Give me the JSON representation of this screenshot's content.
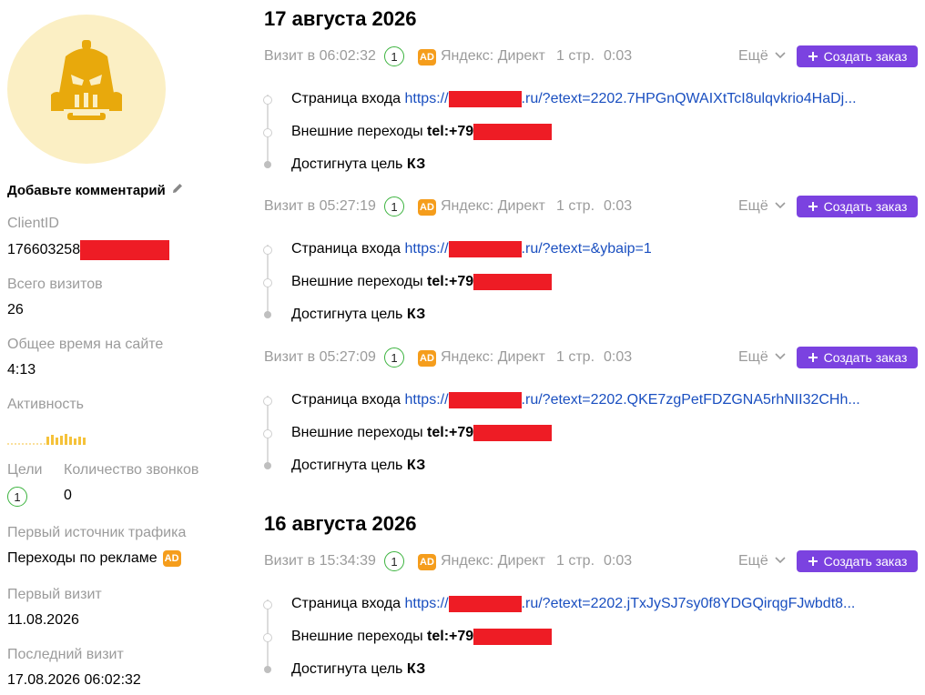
{
  "sidebar": {
    "comment_label": "Добавьте комментарий",
    "client_id_label": "ClientID",
    "client_id_value": "176603258",
    "total_visits_label": "Всего визитов",
    "total_visits_value": "26",
    "total_time_label": "Общее время на сайте",
    "total_time_value": "4:13",
    "activity_label": "Активность",
    "goals_label": "Цели",
    "goals_value": "1",
    "calls_label": "Количество звонков",
    "calls_value": "0",
    "first_source_label": "Первый источник трафика",
    "first_source_value": "Переходы по рекламе",
    "first_visit_label": "Первый визит",
    "first_visit_value": "11.08.2026",
    "last_visit_label": "Последний визит",
    "last_visit_value": "17.08.2026 06:02:32"
  },
  "ad_badge": "AD",
  "dates": [
    "17 августа 2026",
    "16 августа 2026"
  ],
  "visits": [
    {
      "time": "Визит в 06:02:32",
      "goals": "1",
      "source": "Яндекс: Директ",
      "pages": "1 стр.",
      "duration": "0:03",
      "more": "Ещё",
      "create": "Создать заказ",
      "entry_label": "Страница входа",
      "entry_prefix": "https://",
      "entry_suffix": ".ru/?etext=2202.7HPGnQWAIXtTcI8ulqvkrio4HaDj...",
      "ext_label": "Внешние переходы",
      "ext_value": "tel:+79",
      "goal_label": "Достигнута цель",
      "goal_value": "КЗ"
    },
    {
      "time": "Визит в 05:27:19",
      "goals": "1",
      "source": "Яндекс: Директ",
      "pages": "1 стр.",
      "duration": "0:03",
      "more": "Ещё",
      "create": "Создать заказ",
      "entry_label": "Страница входа",
      "entry_prefix": "https://",
      "entry_suffix": ".ru/?etext=&ybaip=1",
      "ext_label": "Внешние переходы",
      "ext_value": "tel:+79",
      "goal_label": "Достигнута цель",
      "goal_value": "КЗ"
    },
    {
      "time": "Визит в 05:27:09",
      "goals": "1",
      "source": "Яндекс: Директ",
      "pages": "1 стр.",
      "duration": "0:03",
      "more": "Ещё",
      "create": "Создать заказ",
      "entry_label": "Страница входа",
      "entry_prefix": "https://",
      "entry_suffix": ".ru/?etext=2202.QKE7zgPetFDZGNA5rhNII32CHh...",
      "ext_label": "Внешние переходы",
      "ext_value": "tel:+79",
      "goal_label": "Достигнута цель",
      "goal_value": "КЗ"
    },
    {
      "time": "Визит в 15:34:39",
      "goals": "1",
      "source": "Яндекс: Директ",
      "pages": "1 стр.",
      "duration": "0:03",
      "more": "Ещё",
      "create": "Создать заказ",
      "entry_label": "Страница входа",
      "entry_prefix": "https://",
      "entry_suffix": ".ru/?etext=2202.jTxJySJ7sy0f8YDGQirqgFJwbdt8...",
      "ext_label": "Внешние переходы",
      "ext_value": "tel:+79",
      "goal_label": "Достигнута цель",
      "goal_value": "КЗ"
    }
  ],
  "colors": {
    "accent": "#7b42e0",
    "redaction": "#ee1c25",
    "link": "#1a4fc0",
    "goal_ring": "#3bb33e",
    "ad": "#f59d1c",
    "avatar_bg": "#fbefc4",
    "avatar_fg": "#e8a90c"
  }
}
